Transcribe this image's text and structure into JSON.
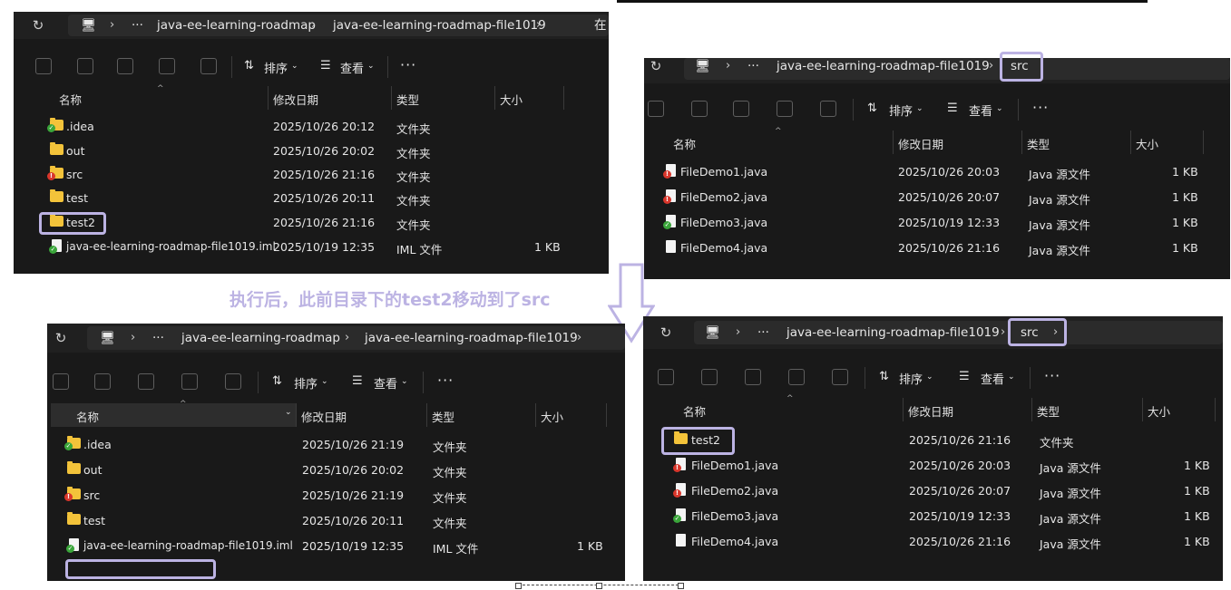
{
  "annotation": "执行后，此前目录下的test2移动到了src",
  "colors": {
    "highlight": "#bcb3e3",
    "annotation_text": "#bcb3e3",
    "panel_bg": "#191919",
    "folder": "#f3c33a"
  },
  "toolbar": {
    "sort": "排序",
    "view": "查看",
    "more": "···"
  },
  "headers": {
    "name": "名称",
    "modified": "修改日期",
    "type": "类型",
    "size": "大小"
  },
  "panel1": {
    "path": [
      "java-ee-learning-roadmap",
      "java-ee-learning-roadmap-file1019"
    ],
    "path_overflow": "在",
    "rows": [
      {
        "name": ".idea",
        "date": "2025/10/26 20:12",
        "type": "文件夹",
        "size": "",
        "icon": "folder-green-icon"
      },
      {
        "name": "out",
        "date": "2025/10/26 20:02",
        "type": "文件夹",
        "size": "",
        "icon": "folder-icon"
      },
      {
        "name": "src",
        "date": "2025/10/26 21:16",
        "type": "文件夹",
        "size": "",
        "icon": "folder-red-icon"
      },
      {
        "name": "test",
        "date": "2025/10/26 20:11",
        "type": "文件夹",
        "size": "",
        "icon": "folder-icon"
      },
      {
        "name": "test2",
        "date": "2025/10/26 21:16",
        "type": "文件夹",
        "size": "",
        "icon": "folder-icon"
      },
      {
        "name": "java-ee-learning-roadmap-file1019.iml",
        "date": "2025/10/19 12:35",
        "type": "IML 文件",
        "size": "1 KB",
        "icon": "iml-file-icon"
      }
    ]
  },
  "panel2": {
    "path": [
      "java-ee-learning-roadmap-file1019",
      "src"
    ],
    "rows": [
      {
        "name": "FileDemo1.java",
        "date": "2025/10/26 20:03",
        "type": "Java 源文件",
        "size": "1 KB",
        "icon": "java-file-red-icon"
      },
      {
        "name": "FileDemo2.java",
        "date": "2025/10/26 20:07",
        "type": "Java 源文件",
        "size": "1 KB",
        "icon": "java-file-red-icon"
      },
      {
        "name": "FileDemo3.java",
        "date": "2025/10/19 12:33",
        "type": "Java 源文件",
        "size": "1 KB",
        "icon": "java-file-green-icon"
      },
      {
        "name": "FileDemo4.java",
        "date": "2025/10/26 21:16",
        "type": "Java 源文件",
        "size": "1 KB",
        "icon": "java-file-icon"
      }
    ]
  },
  "panel3": {
    "path": [
      "java-ee-learning-roadmap",
      "java-ee-learning-roadmap-file1019"
    ],
    "rows": [
      {
        "name": ".idea",
        "date": "2025/10/26 21:19",
        "type": "文件夹",
        "size": "",
        "icon": "folder-green-icon"
      },
      {
        "name": "out",
        "date": "2025/10/26 20:02",
        "type": "文件夹",
        "size": "",
        "icon": "folder-icon"
      },
      {
        "name": "src",
        "date": "2025/10/26 21:19",
        "type": "文件夹",
        "size": "",
        "icon": "folder-red-icon"
      },
      {
        "name": "test",
        "date": "2025/10/26 20:11",
        "type": "文件夹",
        "size": "",
        "icon": "folder-icon"
      },
      {
        "name": "java-ee-learning-roadmap-file1019.iml",
        "date": "2025/10/19 12:35",
        "type": "IML 文件",
        "size": "1 KB",
        "icon": "iml-file-icon"
      }
    ]
  },
  "panel4": {
    "path": [
      "java-ee-learning-roadmap-file1019",
      "src"
    ],
    "rows": [
      {
        "name": "test2",
        "date": "2025/10/26 21:16",
        "type": "文件夹",
        "size": "",
        "icon": "folder-icon"
      },
      {
        "name": "FileDemo1.java",
        "date": "2025/10/26 20:03",
        "type": "Java 源文件",
        "size": "1 KB",
        "icon": "java-file-red-icon"
      },
      {
        "name": "FileDemo2.java",
        "date": "2025/10/26 20:07",
        "type": "Java 源文件",
        "size": "1 KB",
        "icon": "java-file-red-icon"
      },
      {
        "name": "FileDemo3.java",
        "date": "2025/10/19 12:33",
        "type": "Java 源文件",
        "size": "1 KB",
        "icon": "java-file-green-icon"
      },
      {
        "name": "FileDemo4.java",
        "date": "2025/10/26 21:16",
        "type": "Java 源文件",
        "size": "1 KB",
        "icon": "java-file-icon"
      }
    ]
  }
}
